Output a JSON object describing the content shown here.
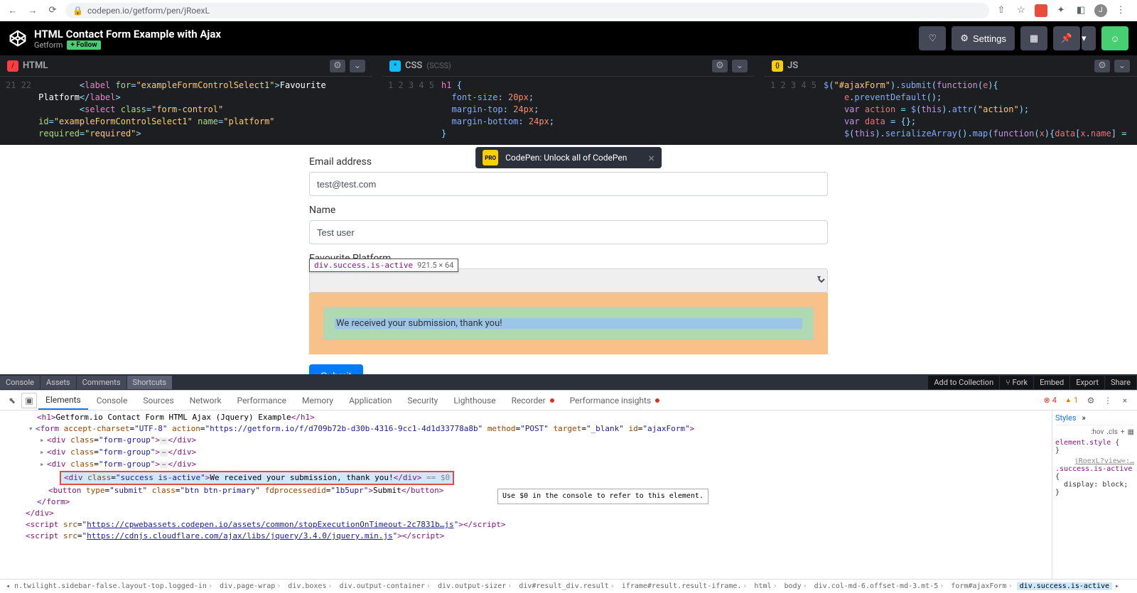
{
  "browser": {
    "url": "codepen.io/getform/pen/jRoexL"
  },
  "codepen": {
    "title": "HTML Contact Form Example with Ajax",
    "author": "Getform",
    "follow_label": "+ Follow",
    "settings_label": "Settings"
  },
  "editors": {
    "html": {
      "name": "HTML",
      "gutter": "21\n\n22\n\n",
      "code_html": "        <span class='t-punc'>&lt;</span><span class='t-tag'>label</span> <span class='t-attr'>for</span><span class='t-punc'>=</span><span class='t-str'>\"exampleFormControlSelect1\"</span><span class='t-punc'>&gt;</span>Favourite\nPlatform<span class='t-punc'>&lt;/</span><span class='t-tag'>label</span><span class='t-punc'>&gt;</span>\n        <span class='t-punc'>&lt;</span><span class='t-tag'>select</span> <span class='t-attr'>class</span><span class='t-punc'>=</span><span class='t-str'>\"form-control\"</span>\n<span class='t-attr'>id</span><span class='t-punc'>=</span><span class='t-str'>\"exampleFormControlSelect1\"</span> <span class='t-attr'>name</span><span class='t-punc'>=</span><span class='t-str'>\"platform\"</span>\n<span class='t-attr'>required</span><span class='t-punc'>=</span><span class='t-str'>\"required\"</span><span class='t-punc'>&gt;</span>"
    },
    "css": {
      "name": "CSS",
      "sub": "(SCSS)",
      "gutter": "1\n2\n3\n4\n5",
      "code_html": "<span class='t-tag'>h1</span> <span class='t-punc'>{</span>\n  <span class='t-prop'>font-size</span><span class='t-punc'>:</span> <span class='t-val'>20px</span><span class='t-punc'>;</span>\n  <span class='t-prop'>margin-top</span><span class='t-punc'>:</span> <span class='t-val'>24px</span><span class='t-punc'>;</span>\n  <span class='t-prop'>margin-bottom</span><span class='t-punc'>:</span> <span class='t-val'>24px</span><span class='t-punc'>;</span>\n<span class='t-punc'>}</span>"
    },
    "js": {
      "name": "JS",
      "gutter": "1\n2\n3\n4\n5",
      "code_html": "<span class='t-fn'>$</span><span class='t-punc'>(</span><span class='t-str'>\"#ajaxForm\"</span><span class='t-punc'>).</span><span class='t-fn'>submit</span><span class='t-punc'>(</span><span class='t-kw'>function</span><span class='t-punc'>(</span><span class='t-var'>e</span><span class='t-punc'>){</span>\n    <span class='t-var'>e</span><span class='t-punc'>.</span><span class='t-fn'>preventDefault</span><span class='t-punc'>();</span>\n    <span class='t-kw'>var</span> <span class='t-var'>action</span> <span class='t-punc'>=</span> <span class='t-fn'>$</span><span class='t-punc'>(</span><span class='t-kw'>this</span><span class='t-punc'>).</span><span class='t-fn'>attr</span><span class='t-punc'>(</span><span class='t-str'>\"action\"</span><span class='t-punc'>);</span>\n    <span class='t-kw'>var</span> <span class='t-var'>data</span> <span class='t-punc'>=</span> <span class='t-punc'>{};</span>\n    <span class='t-fn'>$</span><span class='t-punc'>(</span><span class='t-kw'>this</span><span class='t-punc'>).</span><span class='t-fn'>serializeArray</span><span class='t-punc'>().</span><span class='t-fn'>map</span><span class='t-punc'>(</span><span class='t-kw'>function</span><span class='t-punc'>(</span><span class='t-var'>x</span><span class='t-punc'>){</span><span class='t-var'>data</span><span class='t-punc'>[</span><span class='t-var'>x</span><span class='t-punc'>.</span><span class='t-var'>name</span><span class='t-punc'>]</span> <span class='t-punc'>=</span>"
    }
  },
  "promo": {
    "text": "CodePen: Unlock all of CodePen",
    "badge": "PRO"
  },
  "form": {
    "email_label": "Email address",
    "email_value": "test@test.com",
    "name_label": "Name",
    "name_value": "Test user",
    "platform_label": "Favourite Platform",
    "success_msg": "We received your submission, thank you!",
    "submit_label": "Submit"
  },
  "inspect_tooltip": {
    "selector": "div.success.is-active",
    "dims": "921.5 × 64"
  },
  "footer": {
    "items": [
      "Console",
      "Assets",
      "Comments",
      "Shortcuts"
    ],
    "right": [
      "Add to Collection",
      "Fork",
      "Embed",
      "Export",
      "Share"
    ]
  },
  "devtools": {
    "tabs": [
      "Elements",
      "Console",
      "Sources",
      "Network",
      "Performance",
      "Memory",
      "Application",
      "Security",
      "Lighthouse",
      "Recorder",
      "Performance insights"
    ],
    "active_tab": "Elements",
    "err_count": "4",
    "warn_count": "1",
    "styles_tabs": [
      "Styles"
    ],
    "filter_hov": ":hov",
    "filter_cls": ".cls",
    "rule1_sel": "element.style",
    "rule2_link": "jRoexL?view=:…",
    "rule2_sel": ".success.is-active",
    "rule2_body": "display: block;",
    "dollar_tip": "Use $0 in the console to refer to this element.",
    "crumbs": [
      "n.twilight.sidebar-false.layout-top.logged-in",
      "div.page-wrap",
      "div.boxes",
      "div.output-container",
      "div.output-sizer",
      "div#result_div.result",
      "iframe#result.result-iframe.",
      "html",
      "body",
      "div.col-md-6.offset-md-3.mt-5",
      "form#ajaxForm",
      "div.success.is-active"
    ]
  }
}
